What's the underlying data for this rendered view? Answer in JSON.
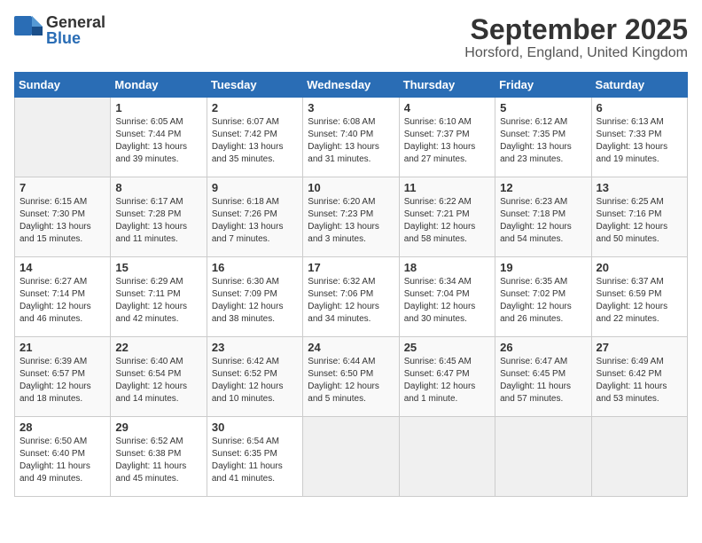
{
  "logo": {
    "text_general": "General",
    "text_blue": "Blue"
  },
  "title": "September 2025",
  "subtitle": "Horsford, England, United Kingdom",
  "weekdays": [
    "Sunday",
    "Monday",
    "Tuesday",
    "Wednesday",
    "Thursday",
    "Friday",
    "Saturday"
  ],
  "weeks": [
    [
      {
        "day": "",
        "info": ""
      },
      {
        "day": "1",
        "info": "Sunrise: 6:05 AM\nSunset: 7:44 PM\nDaylight: 13 hours\nand 39 minutes."
      },
      {
        "day": "2",
        "info": "Sunrise: 6:07 AM\nSunset: 7:42 PM\nDaylight: 13 hours\nand 35 minutes."
      },
      {
        "day": "3",
        "info": "Sunrise: 6:08 AM\nSunset: 7:40 PM\nDaylight: 13 hours\nand 31 minutes."
      },
      {
        "day": "4",
        "info": "Sunrise: 6:10 AM\nSunset: 7:37 PM\nDaylight: 13 hours\nand 27 minutes."
      },
      {
        "day": "5",
        "info": "Sunrise: 6:12 AM\nSunset: 7:35 PM\nDaylight: 13 hours\nand 23 minutes."
      },
      {
        "day": "6",
        "info": "Sunrise: 6:13 AM\nSunset: 7:33 PM\nDaylight: 13 hours\nand 19 minutes."
      }
    ],
    [
      {
        "day": "7",
        "info": "Sunrise: 6:15 AM\nSunset: 7:30 PM\nDaylight: 13 hours\nand 15 minutes."
      },
      {
        "day": "8",
        "info": "Sunrise: 6:17 AM\nSunset: 7:28 PM\nDaylight: 13 hours\nand 11 minutes."
      },
      {
        "day": "9",
        "info": "Sunrise: 6:18 AM\nSunset: 7:26 PM\nDaylight: 13 hours\nand 7 minutes."
      },
      {
        "day": "10",
        "info": "Sunrise: 6:20 AM\nSunset: 7:23 PM\nDaylight: 13 hours\nand 3 minutes."
      },
      {
        "day": "11",
        "info": "Sunrise: 6:22 AM\nSunset: 7:21 PM\nDaylight: 12 hours\nand 58 minutes."
      },
      {
        "day": "12",
        "info": "Sunrise: 6:23 AM\nSunset: 7:18 PM\nDaylight: 12 hours\nand 54 minutes."
      },
      {
        "day": "13",
        "info": "Sunrise: 6:25 AM\nSunset: 7:16 PM\nDaylight: 12 hours\nand 50 minutes."
      }
    ],
    [
      {
        "day": "14",
        "info": "Sunrise: 6:27 AM\nSunset: 7:14 PM\nDaylight: 12 hours\nand 46 minutes."
      },
      {
        "day": "15",
        "info": "Sunrise: 6:29 AM\nSunset: 7:11 PM\nDaylight: 12 hours\nand 42 minutes."
      },
      {
        "day": "16",
        "info": "Sunrise: 6:30 AM\nSunset: 7:09 PM\nDaylight: 12 hours\nand 38 minutes."
      },
      {
        "day": "17",
        "info": "Sunrise: 6:32 AM\nSunset: 7:06 PM\nDaylight: 12 hours\nand 34 minutes."
      },
      {
        "day": "18",
        "info": "Sunrise: 6:34 AM\nSunset: 7:04 PM\nDaylight: 12 hours\nand 30 minutes."
      },
      {
        "day": "19",
        "info": "Sunrise: 6:35 AM\nSunset: 7:02 PM\nDaylight: 12 hours\nand 26 minutes."
      },
      {
        "day": "20",
        "info": "Sunrise: 6:37 AM\nSunset: 6:59 PM\nDaylight: 12 hours\nand 22 minutes."
      }
    ],
    [
      {
        "day": "21",
        "info": "Sunrise: 6:39 AM\nSunset: 6:57 PM\nDaylight: 12 hours\nand 18 minutes."
      },
      {
        "day": "22",
        "info": "Sunrise: 6:40 AM\nSunset: 6:54 PM\nDaylight: 12 hours\nand 14 minutes."
      },
      {
        "day": "23",
        "info": "Sunrise: 6:42 AM\nSunset: 6:52 PM\nDaylight: 12 hours\nand 10 minutes."
      },
      {
        "day": "24",
        "info": "Sunrise: 6:44 AM\nSunset: 6:50 PM\nDaylight: 12 hours\nand 5 minutes."
      },
      {
        "day": "25",
        "info": "Sunrise: 6:45 AM\nSunset: 6:47 PM\nDaylight: 12 hours\nand 1 minute."
      },
      {
        "day": "26",
        "info": "Sunrise: 6:47 AM\nSunset: 6:45 PM\nDaylight: 11 hours\nand 57 minutes."
      },
      {
        "day": "27",
        "info": "Sunrise: 6:49 AM\nSunset: 6:42 PM\nDaylight: 11 hours\nand 53 minutes."
      }
    ],
    [
      {
        "day": "28",
        "info": "Sunrise: 6:50 AM\nSunset: 6:40 PM\nDaylight: 11 hours\nand 49 minutes."
      },
      {
        "day": "29",
        "info": "Sunrise: 6:52 AM\nSunset: 6:38 PM\nDaylight: 11 hours\nand 45 minutes."
      },
      {
        "day": "30",
        "info": "Sunrise: 6:54 AM\nSunset: 6:35 PM\nDaylight: 11 hours\nand 41 minutes."
      },
      {
        "day": "",
        "info": ""
      },
      {
        "day": "",
        "info": ""
      },
      {
        "day": "",
        "info": ""
      },
      {
        "day": "",
        "info": ""
      }
    ]
  ]
}
